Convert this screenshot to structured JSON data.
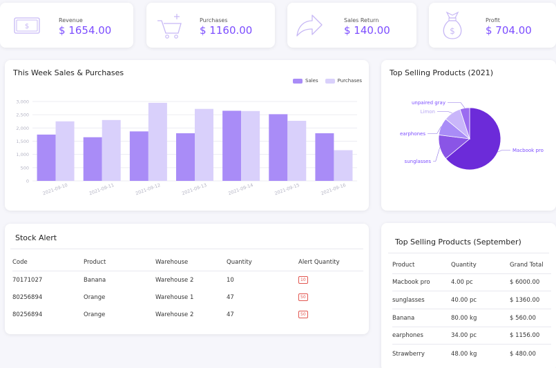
{
  "stats": [
    {
      "label": "Revenue",
      "value": "$ 1654.00",
      "icon": "banknote-icon"
    },
    {
      "label": "Purchases",
      "value": "$ 1160.00",
      "icon": "cart-plus-icon"
    },
    {
      "label": "Sales Return",
      "value": "$ 140.00",
      "icon": "share-arrow-icon"
    },
    {
      "label": "Profit",
      "value": "$ 704.00",
      "icon": "money-bag-icon"
    }
  ],
  "weekly": {
    "title": "This Week Sales & Purchases",
    "legend_sales": "Sales",
    "legend_purchases": "Purchases",
    "colors": {
      "sales": "#a98cf7",
      "purchases": "#d9d0fb"
    }
  },
  "chart_data": {
    "type": "bar",
    "title": "This Week Sales & Purchases",
    "categories": [
      "2021-09-10",
      "2021-09-11",
      "2021-09-12",
      "2021-09-13",
      "2021-09-14",
      "2021-09-15",
      "2021-09-16"
    ],
    "series": [
      {
        "name": "Sales",
        "values": [
          1750,
          1650,
          1870,
          1800,
          2650,
          2520,
          1800
        ]
      },
      {
        "name": "Purchases",
        "values": [
          2250,
          2300,
          2950,
          2720,
          2640,
          2270,
          1160
        ]
      }
    ],
    "yticks": [
      "0",
      "500",
      "1,000",
      "1,500",
      "2,000",
      "2,500",
      "3,000"
    ],
    "ylim": [
      0,
      3000
    ],
    "grid": true,
    "legend_position": "top-right"
  },
  "top_year": {
    "title": "Top Selling Products (2021)",
    "slices": [
      {
        "label": "Macbook pro",
        "value": 64,
        "color": "#6c2bd9"
      },
      {
        "label": "sunglasses",
        "value": 13,
        "color": "#8a55e6"
      },
      {
        "label": "earphones",
        "value": 9,
        "color": "#a98cf7"
      },
      {
        "label": "Limon",
        "value": 9,
        "color": "#c9b6fa"
      },
      {
        "label": "unpaired gray",
        "value": 5,
        "color": "#9b6cf0"
      }
    ]
  },
  "stock": {
    "title": "Stock Alert",
    "headers": [
      "Code",
      "Product",
      "Warehouse",
      "Quantity",
      "Alert Quantity"
    ],
    "rows": [
      {
        "code": "70171027",
        "product": "Banana",
        "warehouse": "Warehouse 2",
        "quantity": "10",
        "alert": "10"
      },
      {
        "code": "80256894",
        "product": "Orange",
        "warehouse": "Warehouse 1",
        "quantity": "47",
        "alert": "50"
      },
      {
        "code": "80256894",
        "product": "Orange",
        "warehouse": "Warehouse 2",
        "quantity": "47",
        "alert": "50"
      }
    ]
  },
  "top_month": {
    "title": "Top Selling Products (September)",
    "headers": [
      "Product",
      "Quantity",
      "Grand Total"
    ],
    "rows": [
      {
        "product": "Macbook pro",
        "quantity": "4.00 pc",
        "total": "$ 6000.00"
      },
      {
        "product": "sunglasses",
        "quantity": "40.00 pc",
        "total": "$ 1360.00"
      },
      {
        "product": "Banana",
        "quantity": "80.00 kg",
        "total": "$ 560.00"
      },
      {
        "product": "earphones",
        "quantity": "34.00 pc",
        "total": "$ 1156.00"
      },
      {
        "product": "Strawberry",
        "quantity": "48.00 kg",
        "total": "$ 480.00"
      }
    ]
  }
}
